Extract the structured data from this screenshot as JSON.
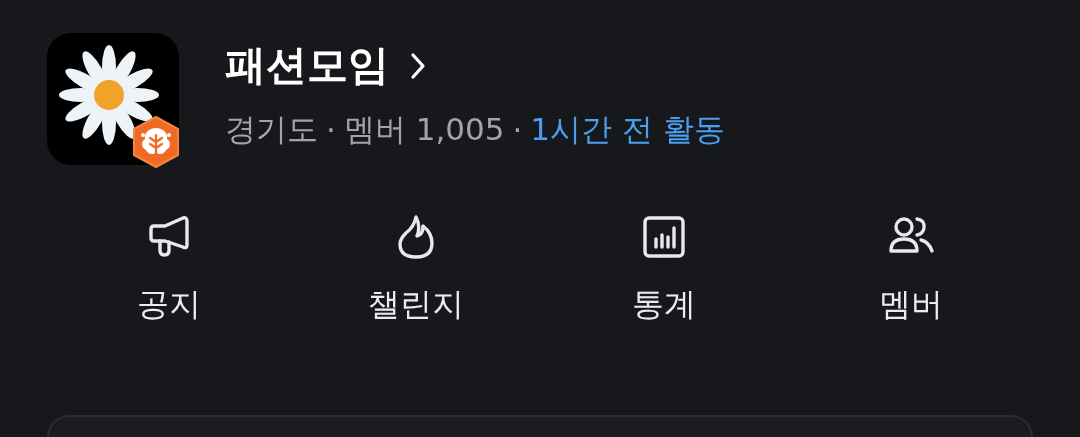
{
  "group": {
    "name": "패션모임",
    "meta": [
      {
        "kind": "plain",
        "text": "경기도"
      },
      {
        "kind": "separator",
        "text": "·"
      },
      {
        "kind": "plain",
        "text": "멤버 1,005"
      },
      {
        "kind": "separator",
        "text": "·"
      },
      {
        "kind": "activity",
        "text": "1시간 전 활동"
      }
    ]
  },
  "menu": [
    {
      "kind": "megaphone",
      "label": "공지"
    },
    {
      "kind": "flame",
      "label": "챌린지"
    },
    {
      "kind": "chart",
      "label": "통계"
    },
    {
      "kind": "people",
      "label": "멤버"
    }
  ]
}
